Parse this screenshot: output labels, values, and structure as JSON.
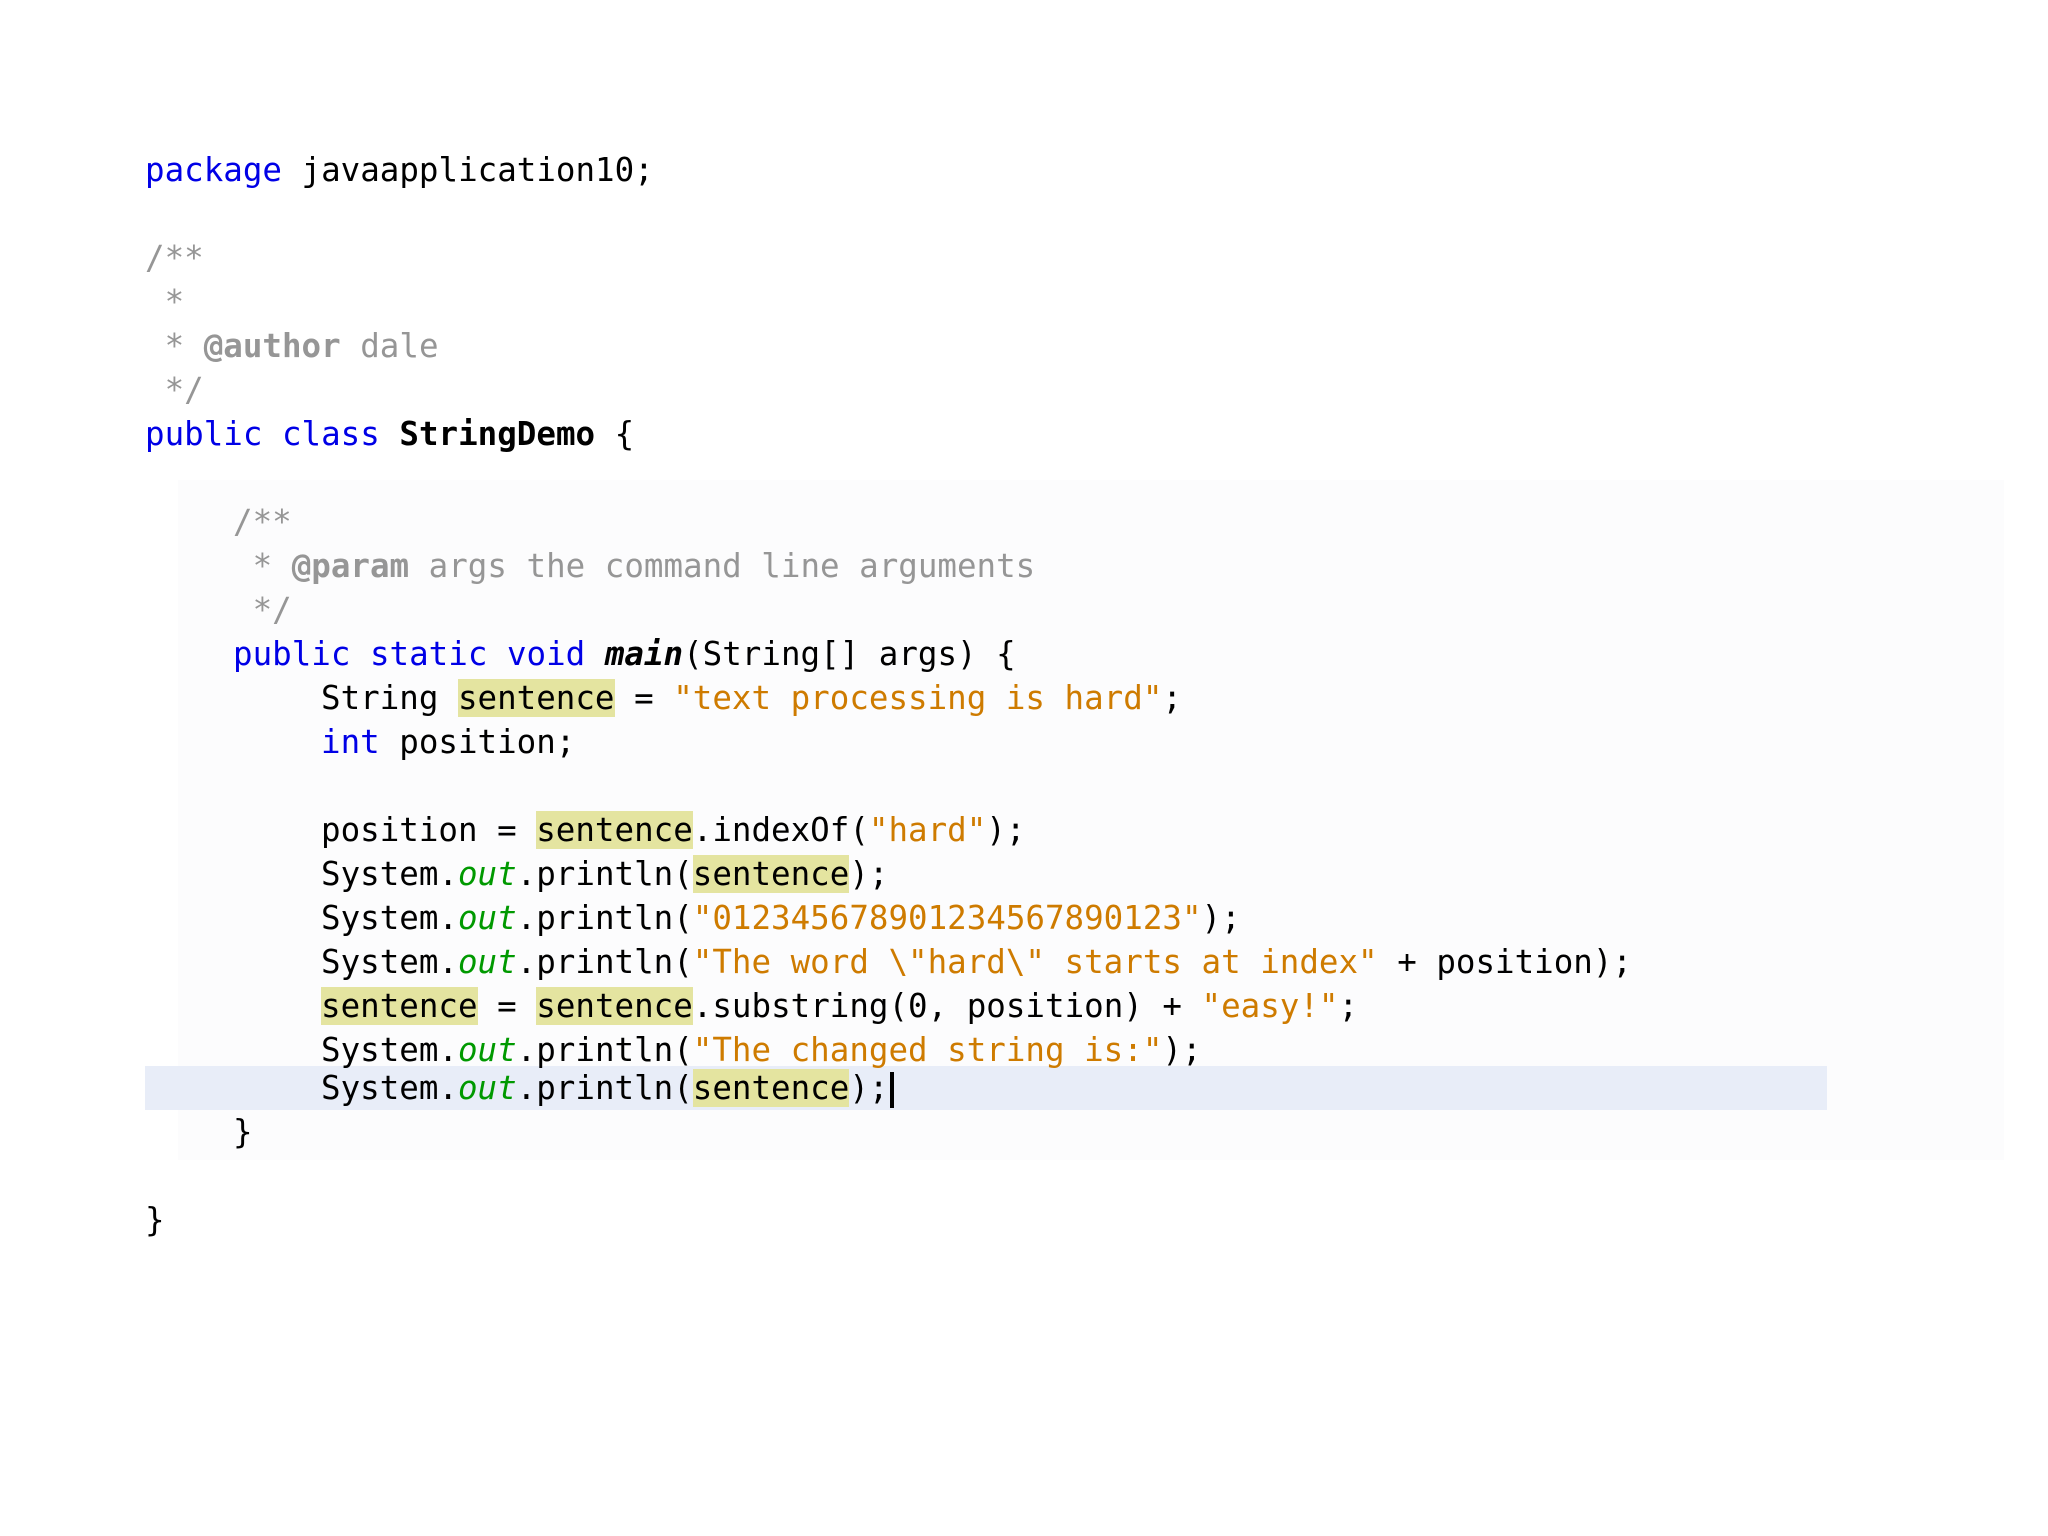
{
  "editor": {
    "language": "java",
    "current_line_color": "#e8edf8",
    "occurrence_highlight_color": "#e4e4a0",
    "keyword_color": "#0000e6",
    "string_color": "#ce7b00",
    "comment_color": "#969696",
    "field_color": "#009900"
  },
  "code": {
    "l1": {
      "kw": "package",
      "rest": " javaapplication10;"
    },
    "l3": "/**",
    "l4": " *",
    "l5": {
      "pre": " * ",
      "tag": "@author",
      "rest": " dale"
    },
    "l6": " */",
    "l7": {
      "kw1": "public",
      "kw2": "class",
      "name": "StringDemo",
      "rest": " {"
    },
    "l9": "/**",
    "l10": {
      "pre": " * ",
      "tag": "@param",
      "rest": " args the command line arguments"
    },
    "l11": " */",
    "l12": {
      "kw1": "public",
      "kw2": "static",
      "kw3": "void",
      "method": "main",
      "rest": "(String[] args) {"
    },
    "l13": {
      "type": "String ",
      "var": "sentence",
      "eq": " = ",
      "str": "\"text processing is hard\"",
      "end": ";"
    },
    "l14": {
      "kw": "int",
      "rest": " position;"
    },
    "l16": {
      "pre": "position = ",
      "var": "sentence",
      "mid": ".indexOf(",
      "str": "\"hard\"",
      "end": ");"
    },
    "l17": {
      "pre": "System.",
      "field": "out",
      "mid": ".println(",
      "var": "sentence",
      "end": ");"
    },
    "l18": {
      "pre": "System.",
      "field": "out",
      "mid": ".println(",
      "str": "\"012345678901234567890123\"",
      "end": ");"
    },
    "l19": {
      "pre": "System.",
      "field": "out",
      "mid": ".println(",
      "str": "\"The word \\\"hard\\\" starts at index\"",
      "end": " + position);"
    },
    "l20": {
      "var1": "sentence",
      "eq": " = ",
      "var2": "sentence",
      "mid": ".substring(0, position) + ",
      "str": "\"easy!\"",
      "end": ";"
    },
    "l21": {
      "pre": "System.",
      "field": "out",
      "mid": ".println(",
      "str": "\"The changed string is:\"",
      "end": ");"
    },
    "l22": {
      "pre": "System.",
      "field": "out",
      "mid": ".println(",
      "var": "sentence",
      "end": ");"
    },
    "l23": "}",
    "l25": "}"
  }
}
